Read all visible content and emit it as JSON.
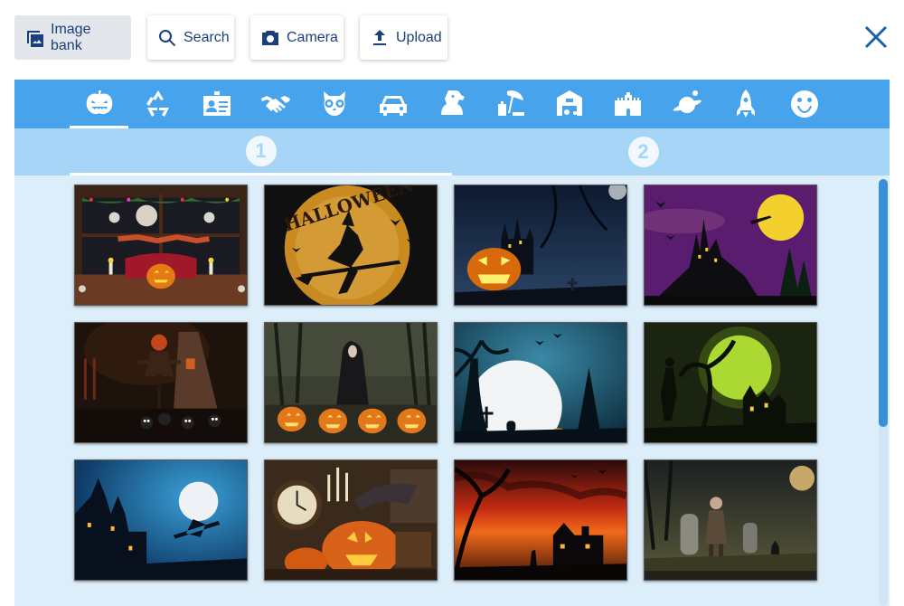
{
  "toolbar": {
    "image_bank_label": "Image bank",
    "search_label": "Search",
    "camera_label": "Camera",
    "upload_label": "Upload"
  },
  "categories": [
    {
      "icon": "pumpkin-icon",
      "active": true
    },
    {
      "icon": "recycle-icon"
    },
    {
      "icon": "id-card-icon"
    },
    {
      "icon": "handshake-icon"
    },
    {
      "icon": "owl-icon"
    },
    {
      "icon": "car-icon"
    },
    {
      "icon": "dog-icon"
    },
    {
      "icon": "beach-umbrella-icon"
    },
    {
      "icon": "barn-icon"
    },
    {
      "icon": "castle-icon"
    },
    {
      "icon": "planet-icon"
    },
    {
      "icon": "rocket-icon"
    },
    {
      "icon": "smiley-icon"
    }
  ],
  "page_tabs": [
    {
      "label": "1",
      "active": true
    },
    {
      "label": "2",
      "active": false
    }
  ],
  "images": [
    {
      "theme": "window-jack-o-lantern"
    },
    {
      "theme": "halloween-witch-moon",
      "text": "HALLOWEEN"
    },
    {
      "theme": "pumpkin-castle-night"
    },
    {
      "theme": "purple-castle-moon"
    },
    {
      "theme": "scarecrow-house"
    },
    {
      "theme": "nun-pumpkins-forest"
    },
    {
      "theme": "full-moon-tree-graves"
    },
    {
      "theme": "green-moon-haunted-house"
    },
    {
      "theme": "blue-witch-house"
    },
    {
      "theme": "clock-pumpkin-still-life"
    },
    {
      "theme": "red-sunset-house"
    },
    {
      "theme": "zombie-graveyard"
    }
  ],
  "colors": {
    "accent": "#47a3eb",
    "tab_bg": "#a7d5f7",
    "grid_bg": "#ddeefb",
    "text": "#1b3f7a"
  }
}
